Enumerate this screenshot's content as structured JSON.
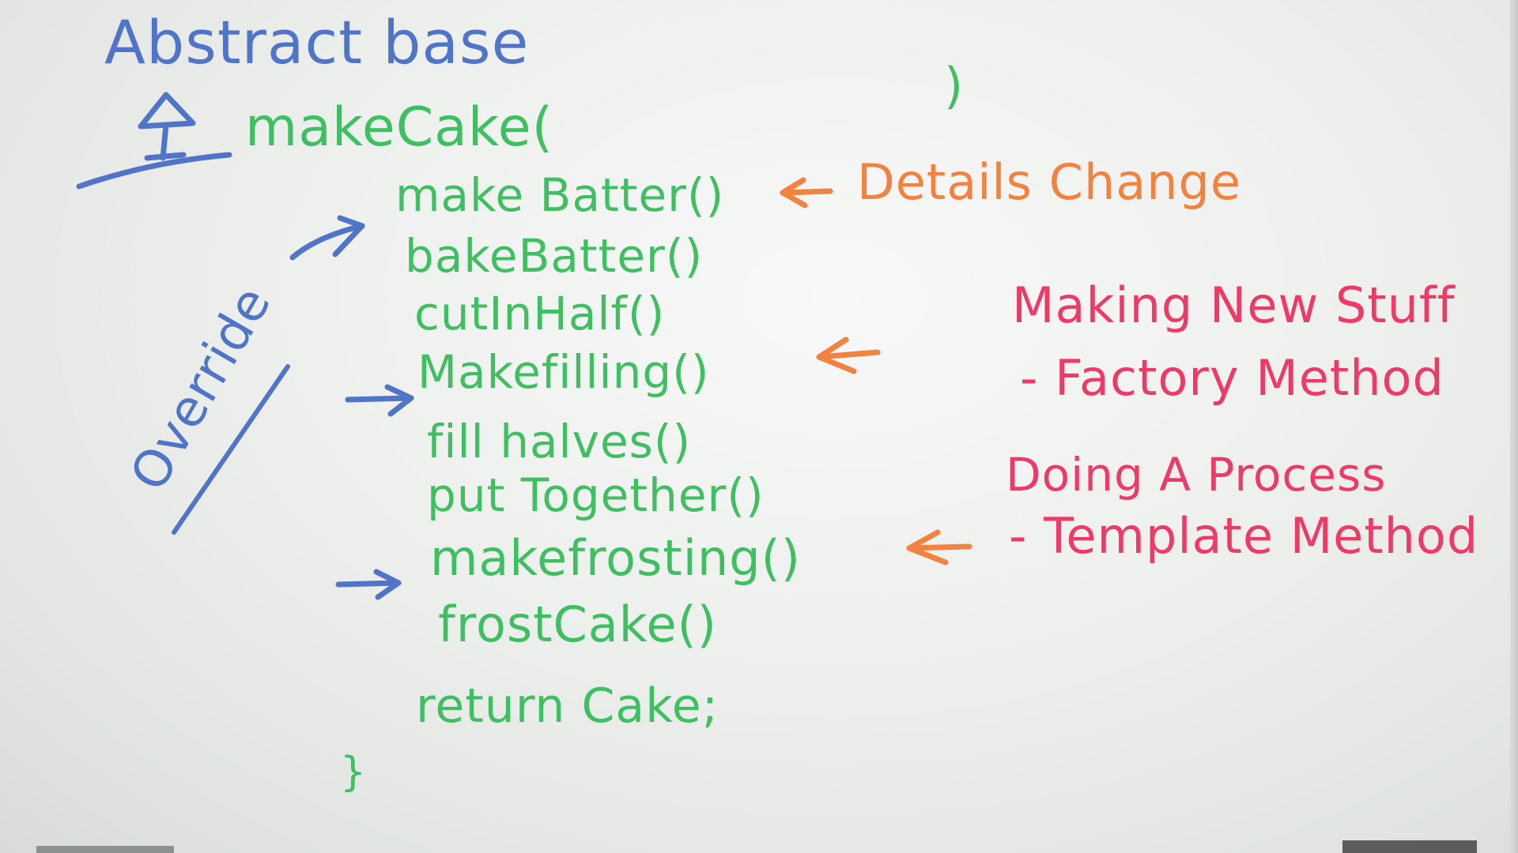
{
  "board": {
    "title": "Abstract base",
    "method_open": "makeCake(",
    "method_close": ")",
    "steps": [
      "make Batter()",
      "bakeBatter()",
      "cutInHalf()",
      "Makefilling()",
      "fill halves()",
      "put Together()",
      "makefrosting()",
      "frostCake()",
      "return Cake;"
    ],
    "closing_brace": "}",
    "side_note": "Override",
    "details_note": "Details Change",
    "new_stuff_heading": "Making New Stuff",
    "factory_method": "- Factory Method",
    "process_heading": "Doing A Process",
    "template_method": "- Template Method"
  },
  "ink_colors": {
    "blue": "#4f74c8",
    "green": "#3fbf62",
    "orange": "#f2823f",
    "red": "#ee3a66"
  }
}
